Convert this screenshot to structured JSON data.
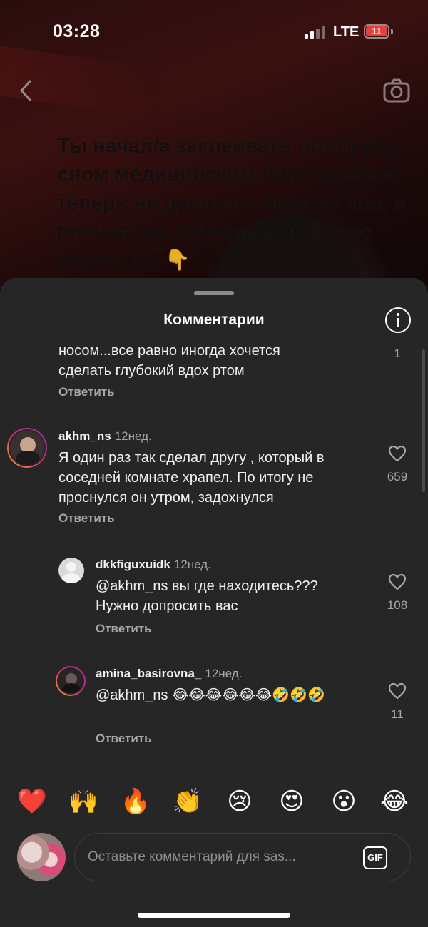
{
  "status_bar": {
    "time": "03:28",
    "network": "LTE",
    "battery": "11"
  },
  "story": {
    "caption": "Ты начал/а заклеивать рот перед сном медицинским пластырем и теперь не дышишь ртом во сне, и получаешь лучший сон за всю жизнь. 😴👇"
  },
  "sheet": {
    "title": "Комментарии"
  },
  "comments": [
    {
      "text": "носом...все равно иногда хочется сделать глубокий вдох ртом",
      "reply": "Ответить",
      "likes": "1"
    },
    {
      "username": "akhm_ns",
      "time": "12нед.",
      "text": "Я один раз так сделал другу , который в соседней комнате храпел. По итогу не проснулся он утром, задохнулся",
      "reply": "Ответить",
      "likes": "659"
    },
    {
      "username": "dkkfiguxuidk",
      "time": "12нед.",
      "text": "@akhm_ns вы где находитесь??? Нужно допросить вас",
      "reply": "Ответить",
      "likes": "108"
    },
    {
      "username": "amina_basirovna_",
      "time": "12нед.",
      "text": "@akhm_ns 😂😂😂😂😂😂🤣🤣🤣",
      "reply": "Ответить",
      "likes": "11"
    }
  ],
  "quick_reactions": [
    "❤️",
    "🙌",
    "🔥",
    "👏",
    "😢",
    "😍",
    "😮",
    "😂"
  ],
  "composer": {
    "placeholder": "Оставьте комментарий для sas...",
    "gif_label": "GIF"
  },
  "colors": {
    "sheet_bg": "#262626",
    "secondary_text": "#a8a8a8",
    "battery_low": "#e0433d"
  }
}
